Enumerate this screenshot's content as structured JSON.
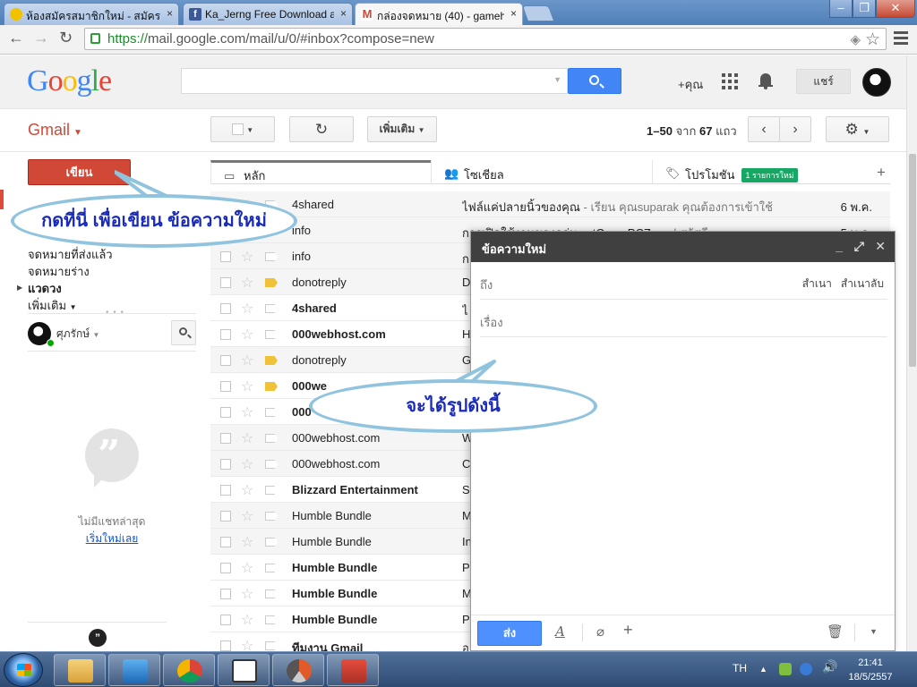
{
  "browser": {
    "tabs": [
      {
        "title": "ห้องสมัครสมาชิกใหม่ - สมัครส",
        "icon": "sun-favicon-icon",
        "color": "#f2c200"
      },
      {
        "title": "Ka_Jerng Free Download a",
        "icon": "facebook-icon",
        "color": "#3b5998"
      },
      {
        "title": "กล่องจดหมาย (40) - gamehi",
        "icon": "gmail-icon",
        "color": "#d14836"
      }
    ],
    "close_glyph": "×",
    "url_scheme": "https://",
    "url_rest": "mail.google.com/mail/u/0/#inbox?compose=new"
  },
  "google_bar": {
    "logo": [
      "G",
      "o",
      "o",
      "g",
      "l",
      "e"
    ],
    "logo_colors": [
      "#4285f4",
      "#ea4335",
      "#fbbc05",
      "#4285f4",
      "#34a853",
      "#ea4335"
    ],
    "plus_you": "+คุณ",
    "share": "แชร์"
  },
  "gmail_bar": {
    "label": "Gmail",
    "more": "เพิ่มเติม",
    "range": "1–50",
    "of": "จาก",
    "total": "67",
    "rows_word": "แถว"
  },
  "nav": {
    "compose": "เขียน",
    "items": [
      {
        "label": "จดหมายที่ส่งแล้ว",
        "bold": false
      },
      {
        "label": "จดหมายร่าง",
        "bold": false
      },
      {
        "label": "แวดวง",
        "bold": true
      },
      {
        "label": "เพิ่มเติม",
        "bold": false
      }
    ],
    "chat_user": "ศุภรักษ์",
    "no_recent_chats": "ไม่มีแชทล่าสุด",
    "start_new": "เริ่มใหม่เลย"
  },
  "inbox_tabs": [
    {
      "label": "หลัก",
      "icon": "inbox-icon"
    },
    {
      "label": "โซเชียล",
      "icon": "people-icon"
    },
    {
      "label": "โปรโมชัน",
      "icon": "tag-icon",
      "badge": "1 รายการใหม่"
    }
  ],
  "messages": [
    {
      "sender": "4shared",
      "subject": "ไฟล์แค่ปลายนิ้วของคุณ",
      "snippet": " - เรียน คุณsuparak คุณต้องการเข้าใช้",
      "date": "6 พ.ค.",
      "unread": false,
      "important": false
    },
    {
      "sender": "info",
      "subject": "การเปิดใช้งานของกลุ่ม xatGamePCZone",
      "snippet": " | สวัสดี",
      "date": "5 พ.ค.",
      "unread": false,
      "important": false
    },
    {
      "sender": "info",
      "subject": "ก",
      "snippet": "",
      "date": "",
      "unread": false,
      "important": false
    },
    {
      "sender": "donotreply",
      "subject": "D",
      "snippet": "",
      "date": "",
      "unread": false,
      "important": true
    },
    {
      "sender": "4shared",
      "subject": "ไ",
      "snippet": "",
      "date": "",
      "unread": true,
      "important": false
    },
    {
      "sender": "000webhost.com",
      "subject": "H",
      "snippet": "",
      "date": "",
      "unread": true,
      "important": false
    },
    {
      "sender": "donotreply",
      "subject": "G",
      "snippet": "",
      "date": "",
      "unread": false,
      "important": true
    },
    {
      "sender": "000we",
      "subject": "",
      "snippet": "",
      "date": "",
      "unread": true,
      "important": true
    },
    {
      "sender": "000",
      "subject": "",
      "snippet": "",
      "date": "",
      "unread": true,
      "important": false
    },
    {
      "sender": "000webhost.com",
      "subject": "W",
      "snippet": "",
      "date": "",
      "unread": false,
      "important": false
    },
    {
      "sender": "000webhost.com",
      "subject": "C",
      "snippet": "",
      "date": "",
      "unread": false,
      "important": false
    },
    {
      "sender": "Blizzard Entertainment",
      "subject": "S",
      "snippet": "",
      "date": "",
      "unread": true,
      "important": false
    },
    {
      "sender": "Humble Bundle",
      "subject": "M",
      "snippet": "",
      "date": "",
      "unread": false,
      "important": false
    },
    {
      "sender": "Humble Bundle",
      "subject": "In",
      "snippet": "",
      "date": "",
      "unread": false,
      "important": false
    },
    {
      "sender": "Humble Bundle",
      "subject": "P",
      "snippet": "",
      "date": "",
      "unread": true,
      "important": false
    },
    {
      "sender": "Humble Bundle",
      "subject": "M",
      "snippet": "",
      "date": "",
      "unread": true,
      "important": false
    },
    {
      "sender": "Humble Bundle",
      "subject": "P",
      "snippet": "",
      "date": "",
      "unread": true,
      "important": false
    },
    {
      "sender": "ทีมงาน Gmail",
      "subject": "อ",
      "snippet": "",
      "date": "",
      "unread": true,
      "important": false
    }
  ],
  "compose_window": {
    "title": "ข้อความใหม่",
    "to": "ถึง",
    "cc": "สำเนา",
    "bcc": "สำเนาลับ",
    "subject": "เรื่อง",
    "send": "ส่ง"
  },
  "callouts": {
    "compose_hint": "กดที่นี่ เพื่อเขียน ข้อความใหม่",
    "result_hint": "จะได้รูปดังนี้"
  },
  "taskbar": {
    "lang": "TH",
    "time": "21:41",
    "date": "18/5/2557"
  }
}
